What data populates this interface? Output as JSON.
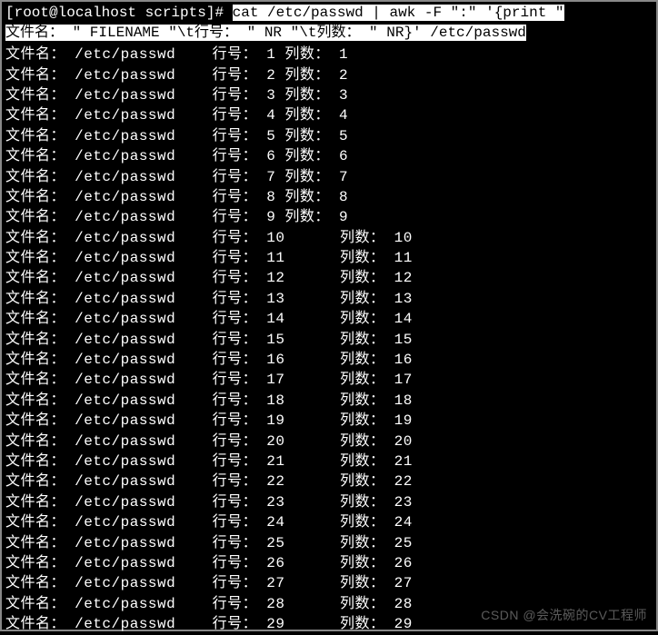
{
  "prompt": {
    "prefix": "[root@localhost scripts]# ",
    "cmd_line1": "cat /etc/passwd | awk -F \":\" '{print \"",
    "cmd_line2": "文件名： \" FILENAME \"\\t行号： \" NR \"\\t列数： \" NR}' /etc/passwd"
  },
  "labels": {
    "filename_label": "文件名：",
    "lineno_label": "行号：",
    "colcount_label": "列数：",
    "filename_value": "/etc/passwd"
  },
  "row_count": 29,
  "watermark": "CSDN @会洗碗的CV工程师"
}
